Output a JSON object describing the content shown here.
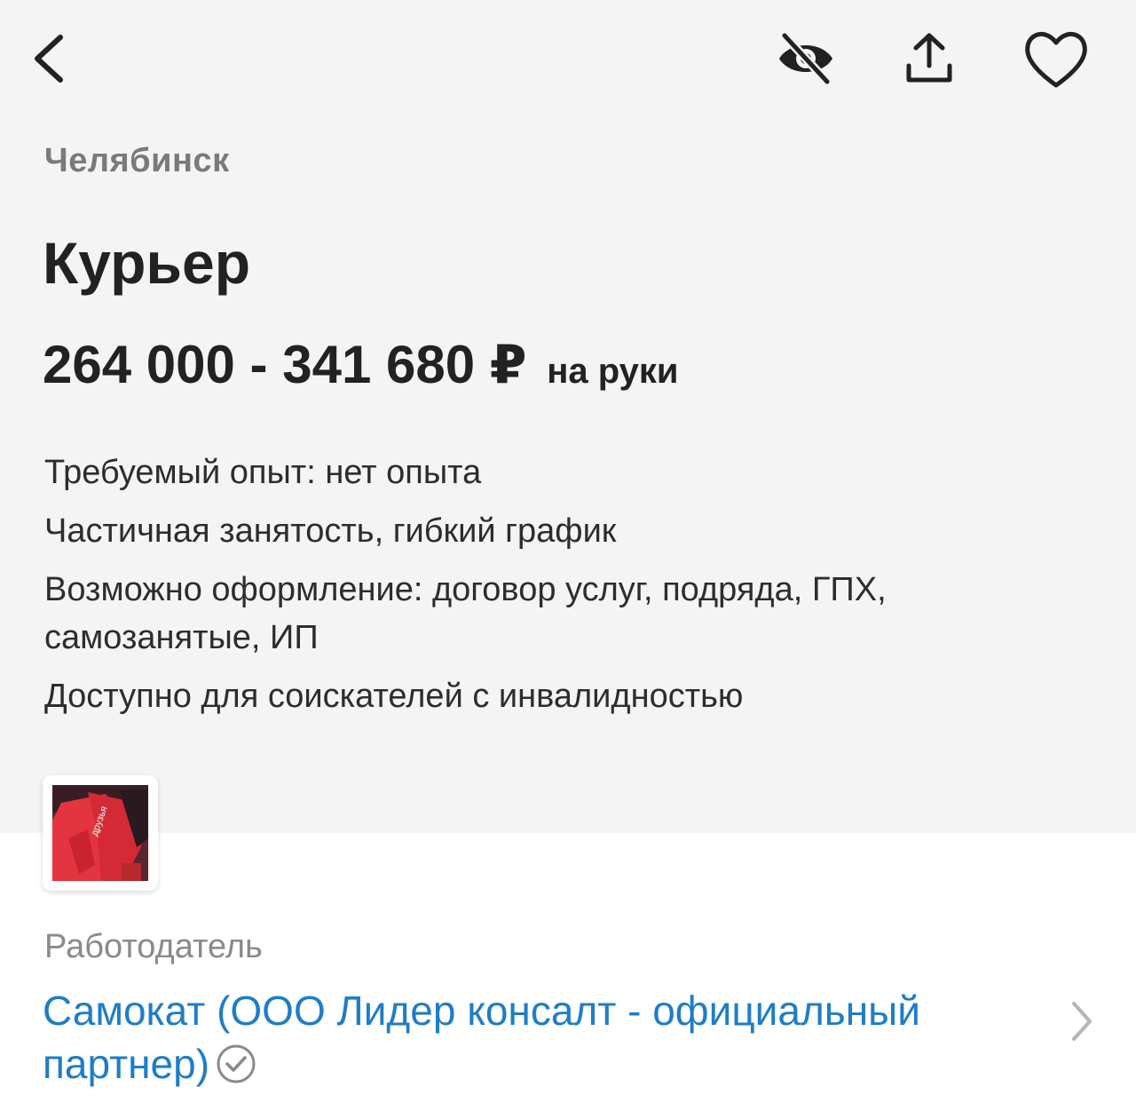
{
  "header": {
    "back_icon": "chevron-left-icon",
    "actions": [
      "eye-off-icon",
      "share-upload-icon",
      "heart-icon"
    ]
  },
  "vacancy": {
    "city": "Челябинск",
    "title": "Курьер",
    "salary": "264 000 - 341 680 ₽",
    "salary_suffix": "на руки",
    "details": [
      "Требуемый опыт: нет опыта",
      "Частичная занятость, гибкий график",
      "Возможно оформление: договор услуг, подряда, ГПХ, самозанятые, ИП",
      "Доступно для соискателей с инвалидностью"
    ]
  },
  "employer": {
    "label": "Работодатель",
    "name": "Самокат (ООО Лидер консалт - официальный партнер)"
  },
  "colors": {
    "accent": "#1e7dc8",
    "background_top": "#f4f4f4",
    "background_bottom": "#ffffff",
    "logo_red": "#e3343f"
  }
}
